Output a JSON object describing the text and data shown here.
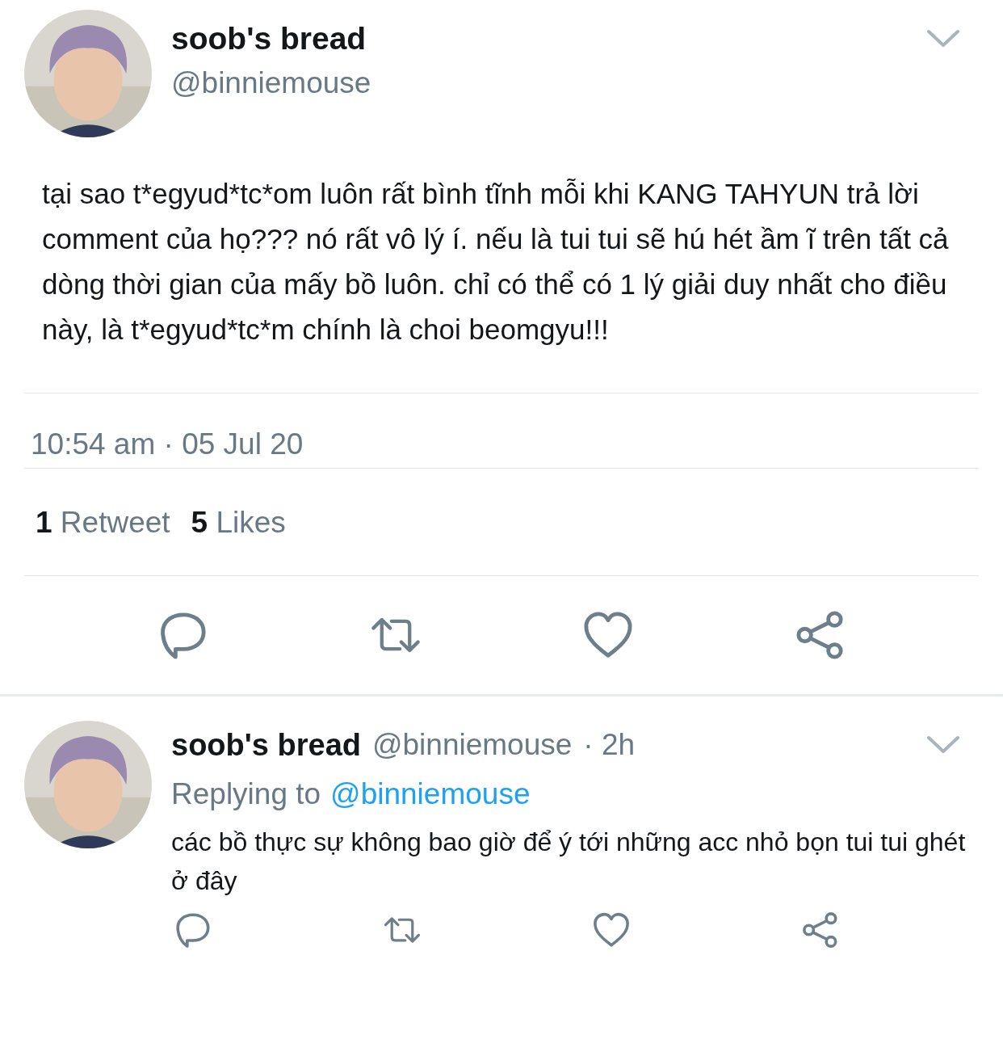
{
  "tweet": {
    "author": {
      "name": "soob's bread",
      "handle": "@binniemouse"
    },
    "text": "tại sao t*egyud*tc*om luôn rất bình tĩnh mỗi khi KANG TAHYUN trả lời comment của họ??? nó rất vô lý í. nếu là tui tui sẽ hú hét ầm ĩ trên tất cả dòng thời gian của mấy bồ luôn. chỉ có thể có 1 lý giải duy nhất cho điều này, là t*egyud*tc*m chính là choi beomgyu!!!",
    "timestamp": "10:54 am · 05 Jul 20",
    "stats": [
      {
        "count": "1",
        "label": "Retweet"
      },
      {
        "count": "5",
        "label": "Likes"
      }
    ],
    "actions": [
      {
        "kind": "reply"
      },
      {
        "kind": "retweet"
      },
      {
        "kind": "like"
      },
      {
        "kind": "share"
      }
    ]
  },
  "reply": {
    "author": {
      "name": "soob's bread",
      "handle": "@binniemouse"
    },
    "time": "· 2h",
    "replying_to": {
      "label": "Replying to",
      "handle": "@binniemouse"
    },
    "text": "các bồ thực sự không bao giờ để ý tới những acc nhỏ bọn tui tui ghét ở đây",
    "actions": [
      {
        "kind": "reply"
      },
      {
        "kind": "retweet"
      },
      {
        "kind": "like"
      },
      {
        "kind": "share"
      }
    ]
  }
}
